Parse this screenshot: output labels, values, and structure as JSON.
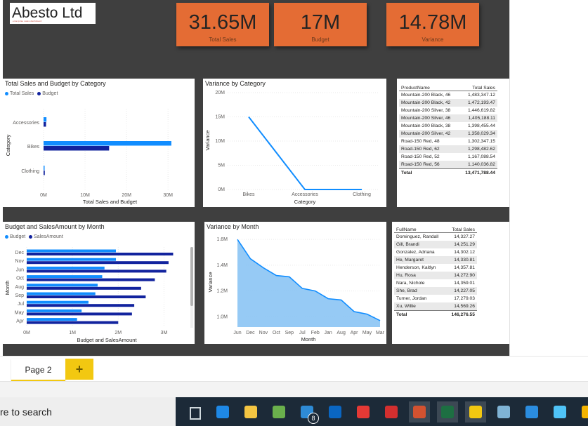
{
  "logo": {
    "text": "Abesto Ltd",
    "sub": "enterprise sales dashboard"
  },
  "kpis": [
    {
      "value": "31.65M",
      "label": "Total Sales"
    },
    {
      "value": "17M",
      "label": "Budget"
    },
    {
      "value": "14.78M",
      "label": "Variance"
    }
  ],
  "colors": {
    "accent": "#e46c34",
    "light_blue": "#118dff",
    "dark_blue": "#12239e",
    "area_fill": "#84c1f3",
    "tab_yellow": "#f2c811"
  },
  "chart1": {
    "title": "Total Sales and Budget by Category",
    "legend": [
      "Total Sales",
      "Budget"
    ],
    "chart_data": {
      "type": "bar",
      "orientation": "horizontal",
      "categories": [
        "Accessories",
        "Bikes",
        "Clothing"
      ],
      "series": [
        {
          "name": "Total Sales",
          "values": [
            0.7,
            30.8,
            0.2
          ]
        },
        {
          "name": "Budget",
          "values": [
            0.6,
            15.8,
            0.3
          ]
        }
      ],
      "xticks": [
        "0M",
        "10M",
        "20M",
        "30M"
      ],
      "xlim": [
        0,
        32
      ],
      "xlabel": "Total Sales and Budget",
      "ylabel": "Category"
    }
  },
  "chart2": {
    "title": "Variance by Category",
    "chart_data": {
      "type": "line",
      "categories": [
        "Bikes",
        "Accessories",
        "Clothing"
      ],
      "values": [
        15,
        0,
        0
      ],
      "yticks": [
        "0M",
        "5M",
        "10M",
        "15M",
        "20M"
      ],
      "ylim": [
        0,
        20
      ],
      "xlabel": "Category",
      "ylabel": "Variance"
    }
  },
  "table1": {
    "headers": [
      "ProductName",
      "Total Sales"
    ],
    "rows": [
      [
        "Mountain-200 Black, 46",
        "1,483,347.12"
      ],
      [
        "Mountain-200 Black, 42",
        "1,472,193.47"
      ],
      [
        "Mountain-200 Silver, 38",
        "1,446,619.82"
      ],
      [
        "Mountain-200 Silver, 46",
        "1,405,188.11"
      ],
      [
        "Mountain-200 Black, 38",
        "1,398,455.44"
      ],
      [
        "Mountain-200 Silver, 42",
        "1,358,029.34"
      ],
      [
        "Road-150 Red, 48",
        "1,302,347.15"
      ],
      [
        "Road-150 Red, 62",
        "1,298,482.62"
      ],
      [
        "Road-150 Red, 52",
        "1,167,088.54"
      ],
      [
        "Road-150 Red, 56",
        "1,140,036.82"
      ]
    ],
    "total_label": "Total",
    "total_value": "13,471,788.44"
  },
  "chart3": {
    "title": "Budget and SalesAmount by Month",
    "legend": [
      "Budget",
      "SalesAmount"
    ],
    "chart_data": {
      "type": "bar",
      "orientation": "horizontal",
      "categories": [
        "Dec",
        "Nov",
        "Jun",
        "Oct",
        "Aug",
        "Sep",
        "Jul",
        "May",
        "Apr"
      ],
      "series": [
        {
          "name": "Budget",
          "values": [
            1.95,
            1.95,
            1.7,
            1.65,
            1.55,
            1.5,
            1.35,
            1.2,
            1.1
          ]
        },
        {
          "name": "SalesAmount",
          "values": [
            3.2,
            3.1,
            3.05,
            2.8,
            2.5,
            2.6,
            2.35,
            2.3,
            2.0
          ]
        }
      ],
      "xticks": [
        "0M",
        "1M",
        "2M",
        "3M"
      ],
      "xlim": [
        0,
        3.5
      ],
      "xlabel": "Budget and SalesAmount",
      "ylabel": "Month"
    }
  },
  "chart4": {
    "title": "Variance by Month",
    "chart_data": {
      "type": "area",
      "categories": [
        "Jun",
        "Dec",
        "Nov",
        "Oct",
        "Sep",
        "Jul",
        "Feb",
        "Jan",
        "Aug",
        "Apr",
        "May",
        "Mar"
      ],
      "values": [
        1.6,
        1.45,
        1.38,
        1.32,
        1.31,
        1.22,
        1.2,
        1.14,
        1.13,
        1.04,
        1.02,
        0.97
      ],
      "yticks": [
        "1.0M",
        "1.2M",
        "1.4M",
        "1.6M"
      ],
      "ylim": [
        0.92,
        1.65
      ],
      "xlabel": "Month",
      "ylabel": "Variance"
    }
  },
  "table2": {
    "headers": [
      "FullName",
      "Total Sales"
    ],
    "rows": [
      [
        "Dominguez, Randall",
        "14,327.27"
      ],
      [
        "Gill, Brandi",
        "14,251.29"
      ],
      [
        "Gonzalez, Adriana",
        "14,302.12"
      ],
      [
        "He, Margaret",
        "14,330.81"
      ],
      [
        "Henderson, Kaitlyn",
        "14,357.81"
      ],
      [
        "Hu, Rosa",
        "14,272.90"
      ],
      [
        "Nara, Nichole",
        "14,359.01"
      ],
      [
        "She, Brad",
        "14,227.05"
      ],
      [
        "Turner, Jordan",
        "17,279.03"
      ],
      [
        "Xu, Willie",
        "14,569.26"
      ]
    ],
    "total_label": "Total",
    "total_value": "146,276.55"
  },
  "tabs": {
    "page": "Page 2",
    "add": "+"
  },
  "taskbar": {
    "search_text": "re to search",
    "mail_badge": "8",
    "icons": [
      "task-view-icon",
      "edge-icon",
      "file-explorer-icon",
      "store-icon",
      "mail-icon",
      "linkedin-icon",
      "anydesk-icon",
      "opera-icon",
      "powerpoint-icon",
      "excel-icon",
      "powerbi-icon",
      "onenote-icon",
      "vscode-icon",
      "photos-icon",
      "chrome-icon"
    ]
  }
}
